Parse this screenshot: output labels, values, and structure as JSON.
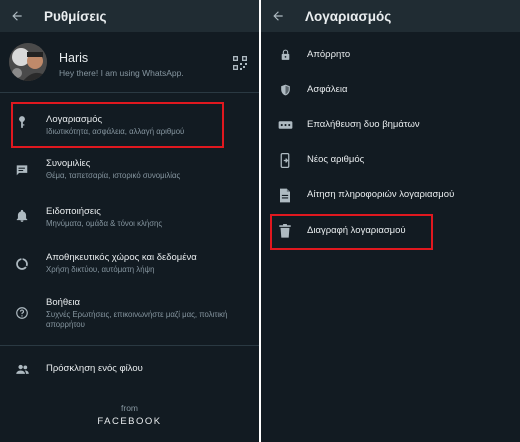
{
  "colors": {
    "background": "#121b22",
    "appbar": "#202c33",
    "icon": "#aebac1",
    "highlight": "#e0181f",
    "secondary_text": "#8696a0"
  },
  "left": {
    "appbar": {
      "back_icon": "arrow-left-icon",
      "title": "Ρυθμίσεις"
    },
    "profile": {
      "name": "Haris",
      "status": "Hey there! I am using WhatsApp.",
      "qr_icon": "qr-code-icon"
    },
    "items": [
      {
        "icon": "key-icon",
        "title": "Λογαριασμός",
        "subtitle": "Ιδιωτικότητα, ασφάλεια, αλλαγή αριθμού",
        "highlighted": true
      },
      {
        "icon": "chat-icon",
        "title": "Συνομιλίες",
        "subtitle": "Θέμα, ταπετσαρία, ιστορικό συνομιλίας"
      },
      {
        "icon": "bell-icon",
        "title": "Ειδοποιήσεις",
        "subtitle": "Μηνύματα, ομάδα & τόνοι κλήσης"
      },
      {
        "icon": "data-usage-icon",
        "title": "Αποθηκευτικός χώρος και δεδομένα",
        "subtitle": "Χρήση δικτύου, αυτόματη λήψη"
      },
      {
        "icon": "help-icon",
        "title": "Βοήθεια",
        "subtitle": "Συχνές Ερωτήσεις, επικοινωνήστε μαζί μας, πολιτική απορρήτου"
      },
      {
        "icon": "people-icon",
        "title": "Πρόσκληση ενός φίλου",
        "subtitle": ""
      }
    ],
    "footer": {
      "from": "from",
      "brand": "FACEBOOK"
    }
  },
  "right": {
    "appbar": {
      "back_icon": "arrow-left-icon",
      "title": "Λογαριασμός"
    },
    "items": [
      {
        "icon": "lock-icon",
        "title": "Απόρρητο"
      },
      {
        "icon": "shield-icon",
        "title": "Ασφάλεια"
      },
      {
        "icon": "dots-icon",
        "title": "Επαλήθευση δυο βημάτων"
      },
      {
        "icon": "phone-swap-icon",
        "title": "Νέος αριθμός"
      },
      {
        "icon": "document-icon",
        "title": "Αίτηση πληροφοριών λογαριασμού"
      },
      {
        "icon": "trash-icon",
        "title": "Διαγραφή λογαριασμού",
        "highlighted": true
      }
    ]
  }
}
